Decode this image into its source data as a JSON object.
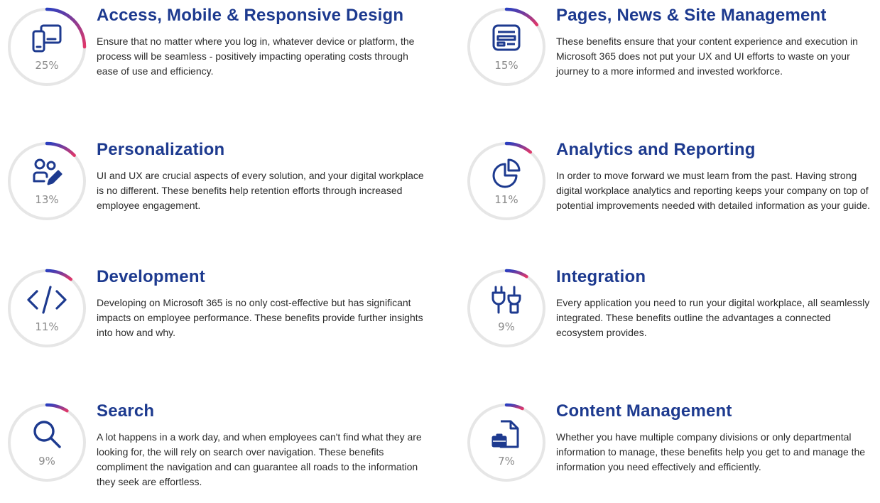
{
  "cards": [
    {
      "title": "Access, Mobile & Responsive Design",
      "percent_label": "25%",
      "percent": 25,
      "icon": "devices-icon",
      "description": "Ensure that no matter where you log in, whatever device or platform, the process will be seamless - positively impacting operating costs through ease of use and efficiency."
    },
    {
      "title": "Pages, News & Site Management",
      "percent_label": "15%",
      "percent": 15,
      "icon": "web-page-icon",
      "description": "These benefits ensure that your content experience and execution in Microsoft 365 does not put your UX and UI efforts to waste on your journey to a more informed and invested workforce."
    },
    {
      "title": "Personalization",
      "percent_label": "13%",
      "percent": 13,
      "icon": "people-edit-icon",
      "description": "UI and UX are crucial aspects of every solution, and your digital workplace is no different. These benefits help retention efforts through increased employee engagement."
    },
    {
      "title": "Analytics and Reporting",
      "percent_label": "11%",
      "percent": 11,
      "icon": "pie-chart-icon",
      "description": "In order to move forward we must learn from the past. Having strong digital workplace analytics and reporting keeps your company on top of potential improvements needed with detailed information as your guide."
    },
    {
      "title": "Development",
      "percent_label": "11%",
      "percent": 11,
      "icon": "code-icon",
      "description": "Developing on Microsoft 365 is no only cost-effective but has significant impacts on employee performance. These benefits provide further insights into how and why."
    },
    {
      "title": "Integration",
      "percent_label": "9%",
      "percent": 9,
      "icon": "plug-connector-icon",
      "description": "Every application you need to run your digital workplace, all seamlessly integrated. These benefits outline the advantages a connected ecosystem provides."
    },
    {
      "title": "Search",
      "percent_label": "9%",
      "percent": 9,
      "icon": "search-icon",
      "description": "A lot happens in a work day, and when employees can't find what they are looking for, the will rely on search over navigation. These benefits compliment the navigation and can guarantee all roads to the information they seek are effortless."
    },
    {
      "title": "Content Management",
      "percent_label": "7%",
      "percent": 7,
      "icon": "document-briefcase-icon",
      "description": "Whether you have multiple company divisions or only departmental information to manage, these benefits help you get to and manage the information you need effectively and efficiently."
    }
  ],
  "colors": {
    "title": "#1d3a8f",
    "icon": "#1d3a8f",
    "track": "#e6e6e6",
    "arc_start": "#2a3fc0",
    "arc_end": "#e0386a"
  }
}
